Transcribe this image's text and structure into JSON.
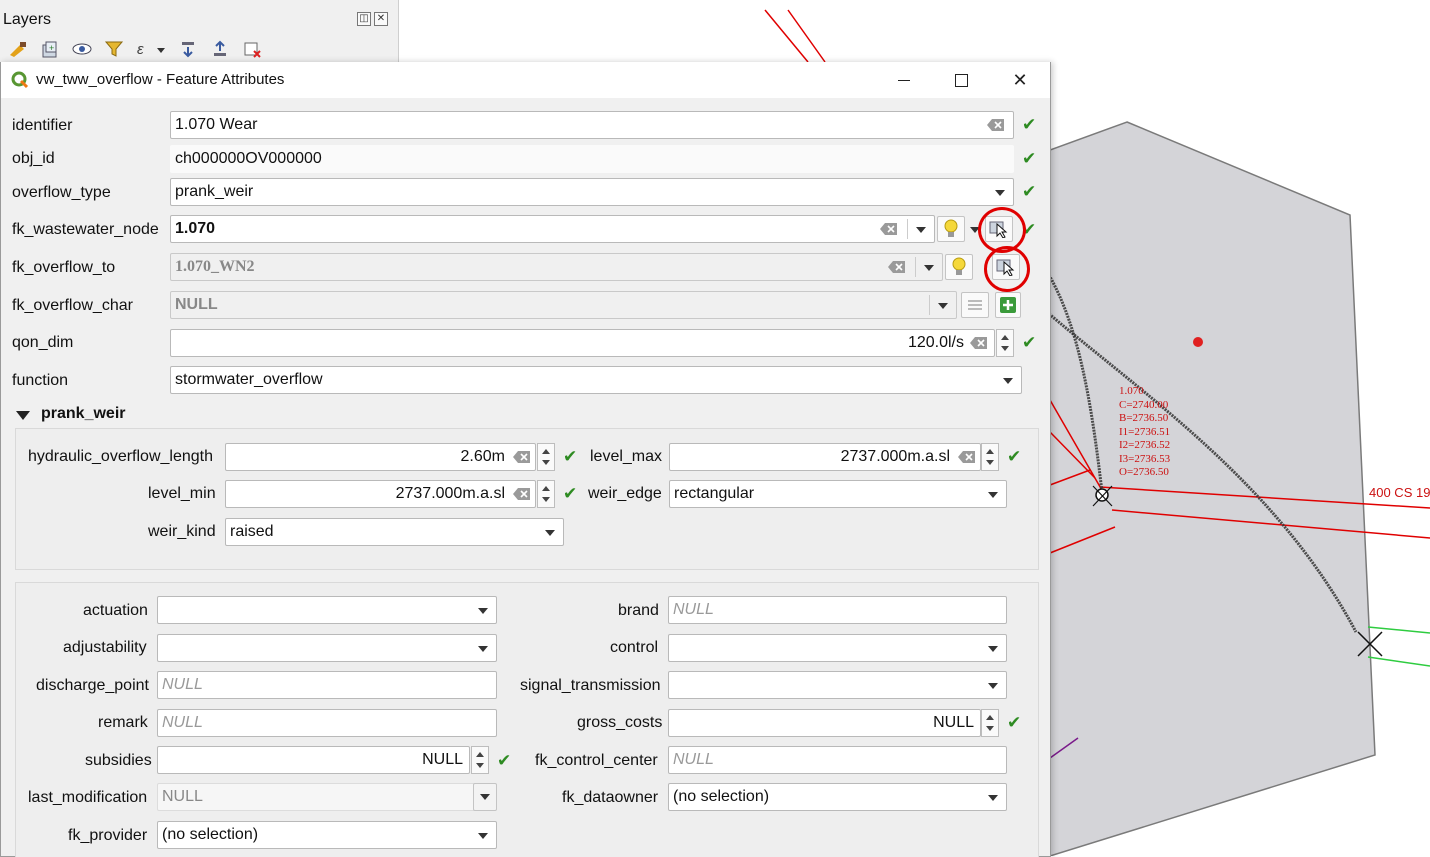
{
  "layers_panel": {
    "title": "Layers"
  },
  "dialog": {
    "title": "vw_tww_overflow - Feature Attributes"
  },
  "fields": {
    "identifier": {
      "label": "identifier",
      "value": "1.070 Wear"
    },
    "obj_id": {
      "label": "obj_id",
      "value": "ch000000OV000000"
    },
    "overflow_type": {
      "label": "overflow_type",
      "value": "prank_weir"
    },
    "fk_wastewater_node": {
      "label": "fk_wastewater_node",
      "value": "1.070"
    },
    "fk_overflow_to": {
      "label": "fk_overflow_to",
      "value": "1.070_WN2"
    },
    "fk_overflow_char": {
      "label": "fk_overflow_char",
      "value": "NULL"
    },
    "qon_dim": {
      "label": "qon_dim",
      "value": "120.0l/s"
    },
    "function": {
      "label": "function",
      "value": "stormwater_overflow"
    }
  },
  "prank_weir": {
    "header": "prank_weir",
    "hydraulic_overflow_length": {
      "label": "hydraulic_overflow_length",
      "value": "2.60m"
    },
    "level_max": {
      "label": "level_max",
      "value": "2737.000m.a.sl"
    },
    "level_min": {
      "label": "level_min",
      "value": "2737.000m.a.sl"
    },
    "weir_edge": {
      "label": "weir_edge",
      "value": "rectangular"
    },
    "weir_kind": {
      "label": "weir_kind",
      "value": "raised"
    }
  },
  "general": {
    "actuation": {
      "label": "actuation",
      "value": ""
    },
    "adjustability": {
      "label": "adjustability",
      "value": ""
    },
    "discharge_point": {
      "label": "discharge_point",
      "placeholder": "NULL"
    },
    "remark": {
      "label": "remark",
      "placeholder": "NULL"
    },
    "subsidies": {
      "label": "subsidies",
      "value": "NULL"
    },
    "last_modification": {
      "label": "last_modification",
      "value": "NULL"
    },
    "fk_provider": {
      "label": "fk_provider",
      "value": "(no selection)"
    },
    "brand": {
      "label": "brand",
      "placeholder": "NULL"
    },
    "control": {
      "label": "control",
      "value": ""
    },
    "signal_transmission": {
      "label": "signal_transmission",
      "value": ""
    },
    "gross_costs": {
      "label": "gross_costs",
      "value": "NULL"
    },
    "fk_control_center": {
      "label": "fk_control_center",
      "placeholder": "NULL"
    },
    "fk_dataowner": {
      "label": "fk_dataowner",
      "value": "(no selection)"
    }
  },
  "map": {
    "node_label_lines": [
      "1.070",
      "C=2740.00",
      "B=2736.50",
      "I1=2736.51",
      "I2=2736.52",
      "I3=2736.53",
      "O=2736.50"
    ],
    "pipe_label": "400 CS 19",
    "colors": {
      "network": "#e00000",
      "polygon_fill": "#d4d4d8",
      "check": "#2e8b22"
    }
  }
}
